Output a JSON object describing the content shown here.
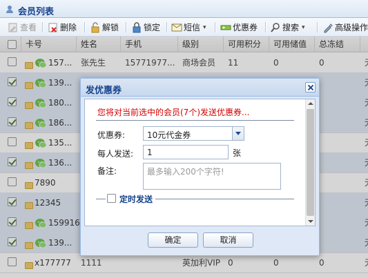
{
  "panel": {
    "title": "会员列表"
  },
  "toolbar": {
    "view": "查看",
    "delete": "删除",
    "unlock": "解锁",
    "lock": "锁定",
    "sms": "短信",
    "coupon": "优惠券",
    "search": "搜索",
    "advanced": "高级操作"
  },
  "columns": [
    "卡号",
    "姓名",
    "手机",
    "级别",
    "可用积分",
    "可用储值",
    "总冻结",
    ""
  ],
  "rows": [
    {
      "card": "157...",
      "name": "张先生",
      "phone": "15771977...",
      "level": "商场会员",
      "points": "11",
      "balance": "0",
      "frozen": "0",
      "extra": "无",
      "checked": false
    },
    {
      "card": "139...",
      "name": "",
      "phone": "",
      "level": "",
      "points": "",
      "balance": "",
      "frozen": "",
      "extra": "无",
      "checked": true
    },
    {
      "card": "180...",
      "name": "",
      "phone": "",
      "level": "",
      "points": "",
      "balance": "",
      "frozen": "",
      "extra": "无",
      "checked": true
    },
    {
      "card": "186...",
      "name": "",
      "phone": "",
      "level": "",
      "points": "",
      "balance": "",
      "frozen": "",
      "extra": "无",
      "checked": true
    },
    {
      "card": "135...",
      "name": "",
      "phone": "",
      "level": "",
      "points": "",
      "balance": "",
      "frozen": "",
      "extra": "无",
      "checked": false
    },
    {
      "card": "136...",
      "name": "",
      "phone": "",
      "level": "",
      "points": "",
      "balance": "",
      "frozen": "",
      "extra": "无",
      "checked": true
    },
    {
      "card": "7890",
      "name": "",
      "phone": "",
      "level": "",
      "points": "",
      "balance": "",
      "frozen": "",
      "extra": "无",
      "checked": false
    },
    {
      "card": "12345",
      "name": "",
      "phone": "",
      "level": "",
      "points": "",
      "balance": "",
      "frozen": "",
      "extra": "无",
      "checked": true
    },
    {
      "card": "159916...",
      "name": "",
      "phone": "",
      "level": "",
      "points": "",
      "balance": "",
      "frozen": "",
      "extra": "无",
      "checked": true
    },
    {
      "card": "139...",
      "name": "",
      "phone": "",
      "level": "",
      "points": "",
      "balance": "",
      "frozen": "",
      "extra": "无",
      "checked": true
    },
    {
      "card": "x177777",
      "name": "1111",
      "phone": "",
      "level": "英加利VIP",
      "points": "0",
      "balance": "0",
      "frozen": "0",
      "extra": "无",
      "checked": false
    }
  ],
  "dialog": {
    "title": "发优惠券",
    "notice": "您将对当前选中的会员(7个)发送优惠券...",
    "coupon_label": "优惠券:",
    "coupon_value": "10元代金券",
    "per_person_label": "每人发送:",
    "per_person_value": "1",
    "unit": "张",
    "note_label": "备注:",
    "note_placeholder": "最多输入200个字符!",
    "scheduled_label": "定时发送",
    "ok": "确定",
    "cancel": "取消"
  }
}
